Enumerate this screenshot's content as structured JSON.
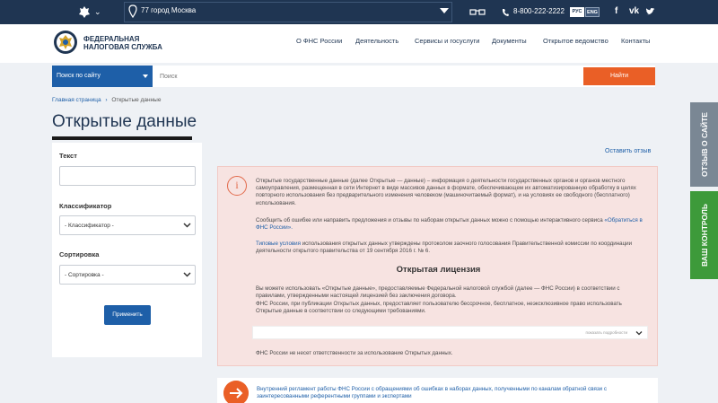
{
  "topbar": {
    "location": "77 город Москва",
    "phone": "8-800-222-2222",
    "lang_ru": "РУС",
    "lang_en": "ENG",
    "social": [
      "f",
      "vk",
      "tw"
    ]
  },
  "header": {
    "logo_line1": "ФЕДЕРАЛЬНАЯ",
    "logo_line2": "НАЛОГОВАЯ СЛУЖБА",
    "nav": [
      "О ФНС России",
      "Деятельность",
      "Сервисы и госуслуги",
      "Документы",
      "Открытое ведомство",
      "Контакты"
    ]
  },
  "search": {
    "scope_label": "Поиск по сайту",
    "placeholder": "Поиск",
    "button": "Найти"
  },
  "breadcrumb": {
    "home": "Главная страница",
    "current": "Открытые данные"
  },
  "page_title": "Открытые данные",
  "filter": {
    "text_label": "Текст",
    "classifier_label": "Классификатор",
    "classifier_value": "- Классификатор -",
    "sort_label": "Сортировка",
    "sort_value": "- Сортировка -",
    "apply_button": "Применить"
  },
  "feedback_link": "Оставить отзыв",
  "info": {
    "para1": "Открытые государственные данные (далее Открытые — данные) – информация о деятельности государственных органов и органов местного самоуправления, размещенная в сети Интернет в виде массивов данных в формате, обеспечивающем их автоматизированную обработку в целях повторного использования без предварительного изменения человеком (машиночитаемый формат), и на условиях ее свободного (бесплатного) использования.",
    "para2_prefix": "Сообщить об ошибке или направить предложения и отзывы по наборам открытых данных можно с помощью интерактивного сервиса",
    "para2_link": "«Обратиться в ФНС России».",
    "para3_link": "Типовые условия",
    "para3_rest": " использования открытых данных утверждены протоколом заочного голосования Правительственной комиссии по координации деятельности открытого правительства от 19 сентября 2016 г. № 6.",
    "license_title": "Открытая лицензия",
    "para4": "Вы можете использовать «Открытые данные», предоставляемые Федеральной налоговой службой (далее — ФНС России) в соответствии с правилами, утвержденными настоящей лицензией без заключения договора.",
    "para5": "ФНС России, при публикации Открытых данных, предоставляет пользователю бессрочное, бесплатное, неэксклюзивное право использовать Открытые данные в соответствии со следующими требованиями.",
    "license_hint": "показать подробности",
    "disclaimer": "ФНС России не несет ответственности за использование Открытых данных."
  },
  "regulation": "Внутренний регламент работы ФНС России с обращениями об ошибках в наборах данных, полученными по каналам обратной связи с заинтересованными референтными группами и экспертами",
  "side_tabs": {
    "feedback": "ОТЗЫВ О САЙТЕ",
    "control": "ВАШ КОНТРОЛЬ"
  },
  "colors": {
    "topbar": "#1f3552",
    "accent_blue": "#1e5fa8",
    "orange": "#ea5f26",
    "info_bg": "#f7e3e1",
    "side_grey": "#7a8794",
    "side_green": "#3d9a3a"
  }
}
